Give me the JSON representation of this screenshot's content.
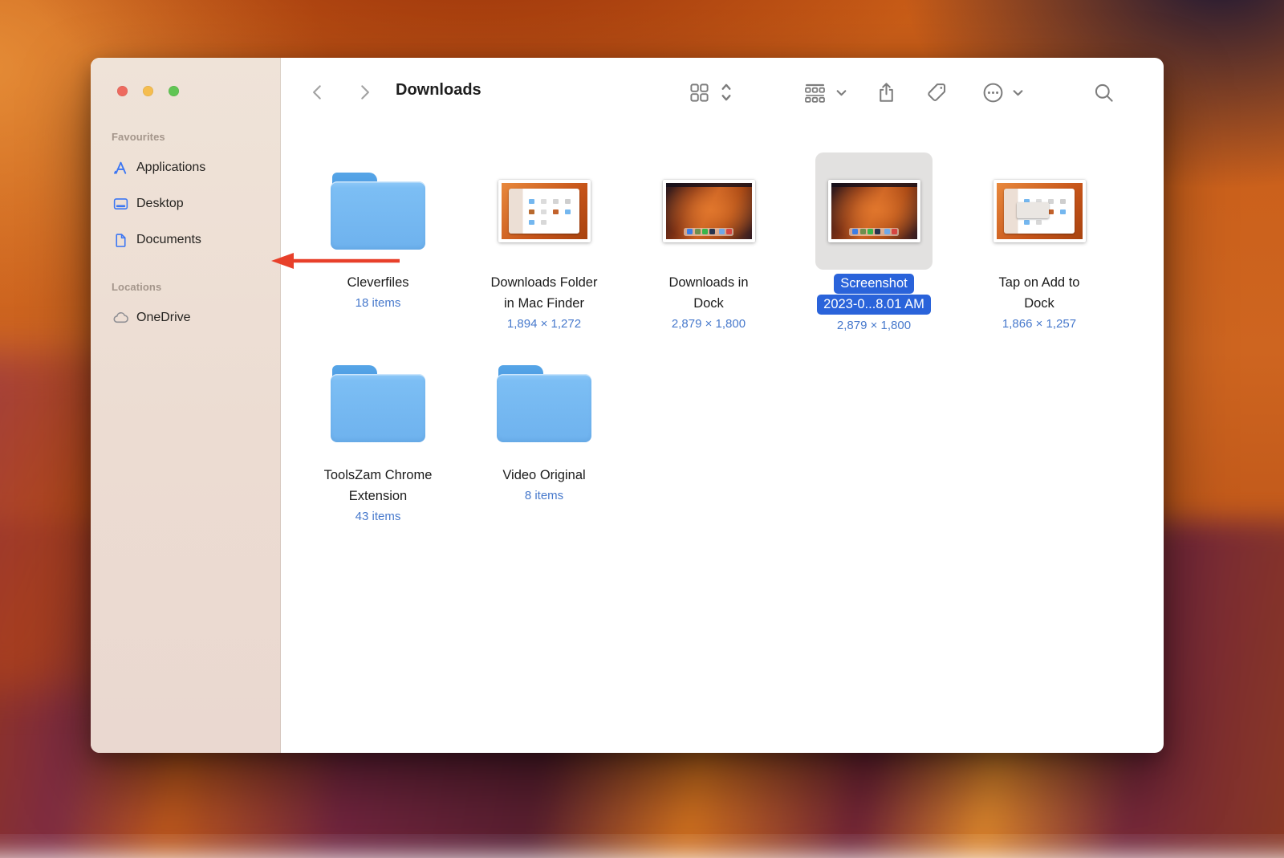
{
  "window": {
    "title": "Downloads",
    "traffic_lights": [
      "close",
      "minimize",
      "zoom"
    ]
  },
  "sidebar": {
    "sections": [
      {
        "title": "Favourites",
        "items": [
          {
            "label": "Applications",
            "icon": "appstore-icon"
          },
          {
            "label": "Desktop",
            "icon": "desktop-icon"
          },
          {
            "label": "Documents",
            "icon": "document-icon"
          }
        ]
      },
      {
        "title": "Locations",
        "items": [
          {
            "label": "OneDrive",
            "icon": "cloud-icon"
          }
        ]
      }
    ]
  },
  "toolbar": {
    "icons": [
      "back",
      "forward",
      "view-grid",
      "sort-options",
      "group-options",
      "share",
      "tag",
      "more-options",
      "search"
    ]
  },
  "files": [
    {
      "name": "Cleverfiles",
      "name2": "",
      "meta": "18 items",
      "type": "folder",
      "selected": false
    },
    {
      "name": "Downloads Folder",
      "name2": "in Mac Finder",
      "meta": "1,894 × 1,272",
      "type": "image-finder",
      "selected": false
    },
    {
      "name": "Downloads in",
      "name2": "Dock",
      "meta": "2,879 × 1,800",
      "type": "image-desktop",
      "selected": false
    },
    {
      "name": "Screenshot",
      "name2": "2023-0...8.01 AM",
      "meta": "2,879 × 1,800",
      "type": "image-desktop",
      "selected": true
    },
    {
      "name": "Tap on Add to",
      "name2": "Dock",
      "meta": "1,866 × 1,257",
      "type": "image-finder-menu",
      "selected": false
    },
    {
      "name": "ToolsZam Chrome",
      "name2": "Extension",
      "meta": "43 items",
      "type": "folder",
      "selected": false
    },
    {
      "name": "Video Original",
      "name2": "",
      "meta": "8 items",
      "type": "folder",
      "selected": false
    }
  ],
  "colors": {
    "selection_blue": "#2A63DA",
    "meta_blue": "#4779CC",
    "sidebar_bg": "#ECDCD2",
    "annotation_red": "#E8402A",
    "folder_blue": "#6EB2EE"
  }
}
